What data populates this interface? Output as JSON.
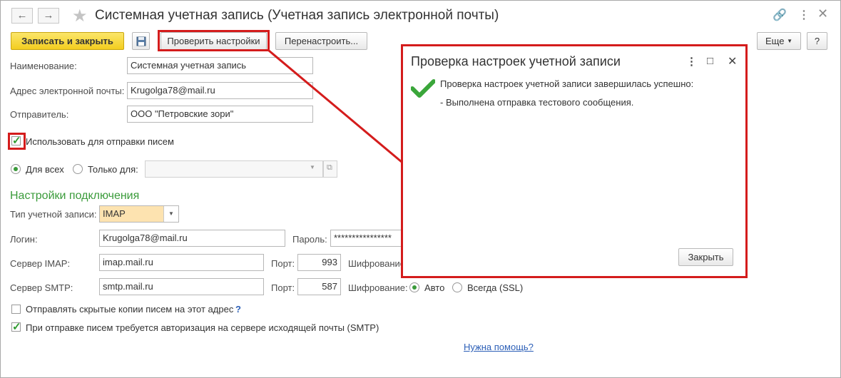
{
  "window": {
    "back_icon": "arrow-left-icon",
    "forward_icon": "arrow-right-icon",
    "favorite_icon": "star-icon",
    "title": "Системная учетная запись (Учетная запись электронной почты)",
    "link_icon": "link-icon",
    "more_icon": "more-vertical-icon",
    "close_icon": "close-icon"
  },
  "toolbar": {
    "save_close_label": "Записать и закрыть",
    "save_icon": "floppy-disk-icon",
    "check_settings_label": "Проверить настройки",
    "reconfigure_label": "Перенастроить...",
    "more_label": "Еще",
    "help_label": "?"
  },
  "form": {
    "name_label": "Наименование:",
    "name_value": "Системная учетная запись",
    "email_label": "Адрес электронной почты:",
    "email_value": "Krugolga78@mail.ru",
    "sender_label": "Отправитель:",
    "sender_value": "ООО \"Петровские зори\"",
    "use_for_sending_label": "Использовать для отправки писем",
    "use_for_sending_checked": true,
    "for_all_label": "Для всех",
    "only_for_label": "Только для:",
    "only_for_value": ""
  },
  "connection": {
    "section_title": "Настройки подключения",
    "account_type_label": "Тип учетной записи:",
    "account_type_value": "IMAP",
    "login_label": "Логин:",
    "login_value": "Krugolga78@mail.ru",
    "password_label": "Пароль:",
    "password_value": "****************",
    "imap_label": "Сервер IMAP:",
    "imap_value": "imap.mail.ru",
    "imap_port_label": "Порт:",
    "imap_port_value": "993",
    "imap_encryption_label": "Шифрование",
    "smtp_label": "Сервер SMTP:",
    "smtp_value": "smtp.mail.ru",
    "smtp_port_label": "Порт:",
    "smtp_port_value": "587",
    "smtp_encryption_label": "Шифрование:",
    "auto_label": "Авто",
    "always_ssl_label": "Всегда (SSL)",
    "bcc_label": "Отправлять скрытые копии писем на этот адрес",
    "bcc_help": "?",
    "smtp_auth_label": "При отправке писем требуется авторизация на сервере исходящей почты (SMTP)",
    "help_link": "Нужна помощь?"
  },
  "dialog": {
    "title": "Проверка настроек учетной записи",
    "success_icon": "checkmark-icon",
    "message_1": "Проверка настроек учетной записи завершилась успешно:",
    "message_2": "- Выполнена отправка тестового сообщения.",
    "close_label": "Закрыть"
  },
  "colors": {
    "highlight": "#d41c1c",
    "section_green": "#3a9b3a",
    "primary_button": "#f3cd1f",
    "account_type_bg": "#fde3b0",
    "link": "#2c5fb7"
  }
}
